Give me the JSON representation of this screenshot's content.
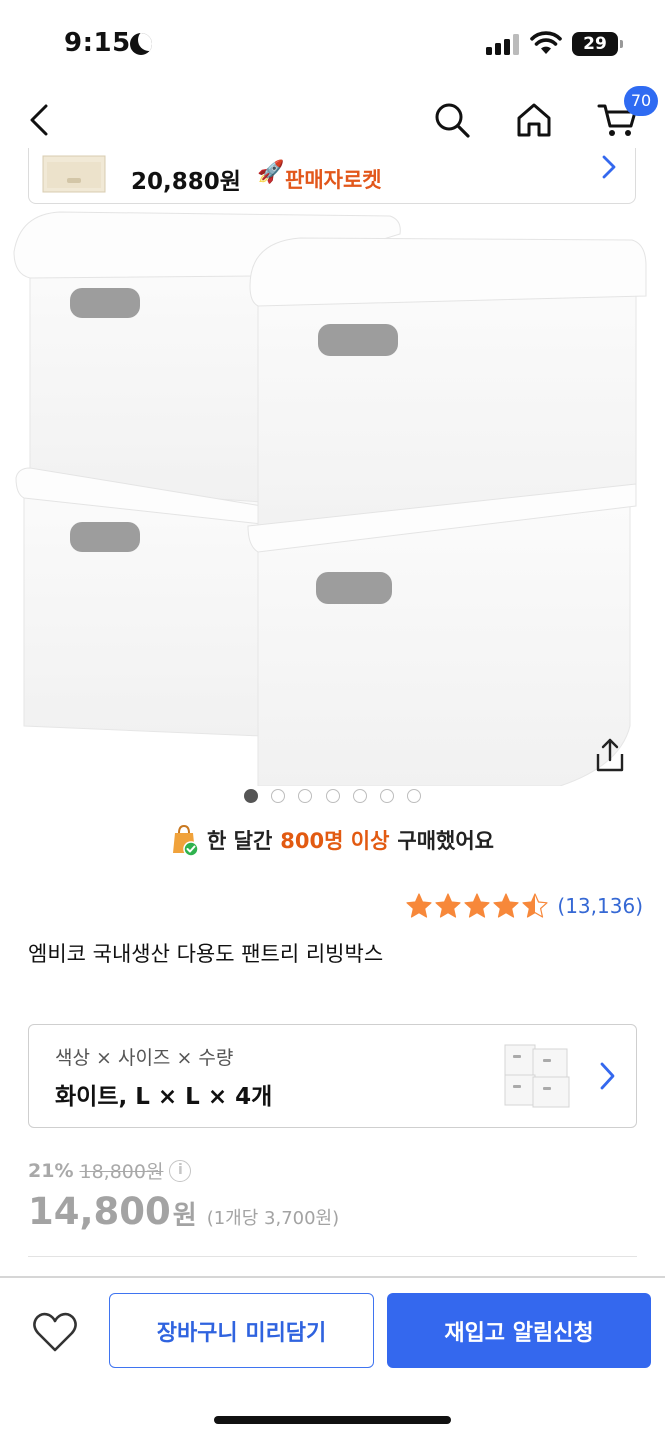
{
  "status_bar": {
    "time": "9:15",
    "battery": "29"
  },
  "nav": {
    "back_icon": "chevron-left-icon",
    "search_icon": "search-icon",
    "home_icon": "home-icon",
    "cart_icon": "cart-icon",
    "cart_count": "70"
  },
  "seller_banner": {
    "price": "20,880원",
    "badge_label": "판매자로켓",
    "badge_icon": "rocket-icon"
  },
  "carousel": {
    "total_slides": 7,
    "active_index": 0
  },
  "purchase_note": {
    "prefix": "한 달간",
    "highlight": "800명 이상",
    "suffix": "구매했어요"
  },
  "rating": {
    "value": 4.5,
    "max": 5,
    "review_count": "(13,136)"
  },
  "product": {
    "title": "엠비코 국내생산 다용도 팬트리 리빙박스"
  },
  "option": {
    "label": "색상 × 사이즈 × 수량",
    "value": "화이트, L × L × 4개"
  },
  "price": {
    "discount_rate": "21%",
    "original_price": "18,800원",
    "sale_price": "14,800",
    "currency": "원",
    "unit_price": "(1개당 3,700원)"
  },
  "actions": {
    "wishlist_icon": "heart-icon",
    "cart_label": "장바구니 미리담기",
    "restock_label": "재입고 알림신청"
  },
  "colors": {
    "accent": "#3468ee",
    "rocket": "#e2571b",
    "highlight": "#e25a11",
    "review_link": "#3568d4",
    "star": "#f7883a"
  }
}
